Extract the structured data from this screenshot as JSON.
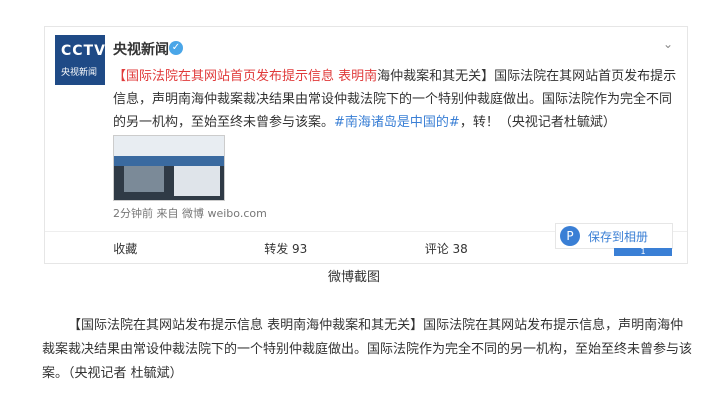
{
  "post": {
    "account_name": "央视新闻",
    "avatar_brand": "CCTV",
    "avatar_sub": "央视新闻",
    "text_red": "【国际法院在其网站首页发布提示信息 表明南",
    "text_black_1": "海仲裁案和其无关】国际法院在其网站首页发布提示信息，声明南海仲裁案裁决结果由常设仲裁法院下的一个特别仲裁庭做出。国际法院作为完全不同的另一机构，至始至终未曾参与该案。",
    "hashtag": "#南海诸岛是中国的#",
    "text_black_2": "，转！（央视记者杜毓斌）",
    "meta": "2分钟前 来自 微博 weibo.com",
    "actions": {
      "favorite": "收藏",
      "repost": "转发 93",
      "comment": "评论 38"
    },
    "save_button": {
      "label": "保存到相册",
      "badge": "1"
    }
  },
  "caption": "微博截图",
  "article": {
    "paragraph": "【国际法院在其网站发布提示信息 表明南海仲裁案和其无关】国际法院在其网站发布提示信息，声明南海仲裁案裁决结果由常设仲裁法院下的一个特别仲裁庭做出。国际法院作为完全不同的另一机构，至始至终未曾参与该案。（央视记者 杜毓斌）"
  }
}
